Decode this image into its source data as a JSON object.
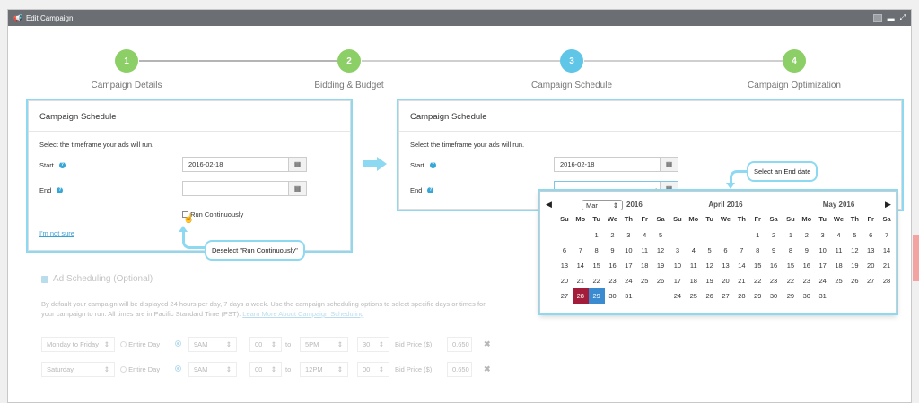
{
  "window": {
    "title": "Edit Campaign"
  },
  "wizard": {
    "steps": [
      {
        "num": "1",
        "label": "Campaign Details"
      },
      {
        "num": "2",
        "label": "Bidding & Budget"
      },
      {
        "num": "3",
        "label": "Campaign Schedule"
      },
      {
        "num": "4",
        "label": "Campaign Optimization"
      }
    ]
  },
  "left_panel": {
    "title": "Campaign Schedule",
    "desc": "Select the timeframe your ads will run.",
    "start_label": "Start",
    "end_label": "End",
    "start_value": "2016-02-18",
    "end_value": "",
    "run_continuously": "Run Continuously",
    "not_sure": "I'm not sure"
  },
  "right_panel": {
    "title": "Campaign Schedule",
    "desc": "Select the timeframe your ads will run.",
    "start_label": "Start",
    "end_label": "End",
    "start_value": "2016-02-18",
    "end_value": ""
  },
  "callouts": {
    "deselect": "Deselect \"Run Continuously\"",
    "select_end": "Select an End date"
  },
  "datepicker": {
    "month_select": "Mar",
    "year": "2016",
    "dow": [
      "Su",
      "Mo",
      "Tu",
      "We",
      "Th",
      "Fr",
      "Sa"
    ],
    "months": [
      {
        "title": "",
        "days": [
          "",
          "",
          "1",
          "2",
          "3",
          "4",
          "5",
          "6",
          "7",
          "8",
          "9",
          "10",
          "11",
          "12",
          "13",
          "14",
          "15",
          "16",
          "17",
          "18",
          "19",
          "20",
          "21",
          "22",
          "23",
          "24",
          "25",
          "26",
          "27",
          "28",
          "29",
          "30",
          "31"
        ]
      },
      {
        "title": "April 2016",
        "days": [
          "",
          "",
          "",
          "",
          "",
          "1",
          "2",
          "3",
          "4",
          "5",
          "6",
          "7",
          "8",
          "9",
          "10",
          "11",
          "12",
          "13",
          "14",
          "15",
          "16",
          "17",
          "18",
          "19",
          "20",
          "21",
          "22",
          "23",
          "24",
          "25",
          "26",
          "27",
          "28",
          "29",
          "30"
        ]
      },
      {
        "title": "May 2016",
        "days": [
          "1",
          "2",
          "3",
          "4",
          "5",
          "6",
          "7",
          "8",
          "9",
          "10",
          "11",
          "12",
          "13",
          "14",
          "15",
          "16",
          "17",
          "18",
          "19",
          "20",
          "21",
          "22",
          "23",
          "24",
          "25",
          "26",
          "27",
          "28",
          "29",
          "30",
          "31"
        ]
      }
    ]
  },
  "ad_scheduling": {
    "title": "Ad Scheduling (Optional)",
    "desc": "By default your campaign will be displayed 24 hours per day, 7 days a week. Use the campaign scheduling options to select specific days or times for your campaign to run. All times are in Pacific Standard Time (PST).",
    "learn_more": "Learn More About Campaign Scheduling",
    "rows": [
      {
        "days": "Monday to Friday",
        "entire": "Entire Day",
        "from_h": "9AM",
        "from_m": "00",
        "to": "to",
        "to_h": "5PM",
        "to_m": "30",
        "bid_label": "Bid Price ($)",
        "bid": "0.650"
      },
      {
        "days": "Saturday",
        "entire": "Entire Day",
        "from_h": "9AM",
        "from_m": "00",
        "to": "to",
        "to_h": "12PM",
        "to_m": "00",
        "bid_label": "Bid Price ($)",
        "bid": "0.650"
      }
    ]
  }
}
